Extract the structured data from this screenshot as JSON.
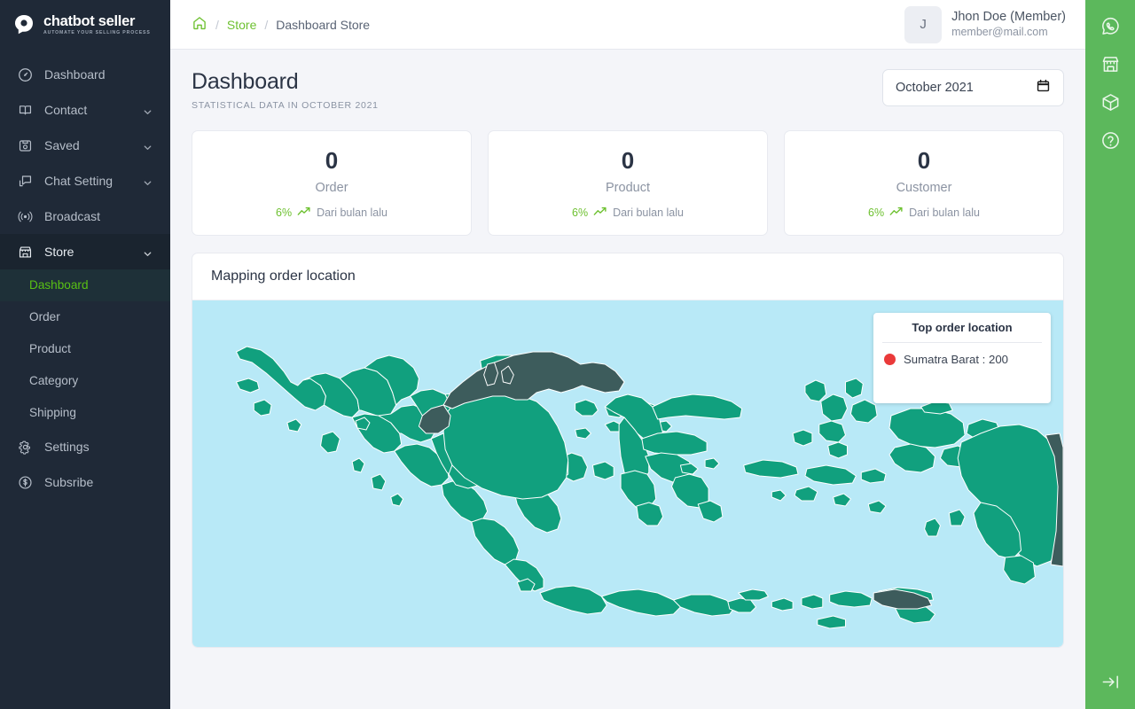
{
  "brand": {
    "name": "chatbot seller",
    "tagline": "AUTOMATE YOUR SELLING PROCESS",
    "logo_icon": "chat-bubble-logo"
  },
  "sidebar": {
    "items": [
      {
        "label": "Dashboard",
        "icon": "gauge-icon",
        "expandable": false,
        "active": false
      },
      {
        "label": "Contact",
        "icon": "book-icon",
        "expandable": true,
        "active": false
      },
      {
        "label": "Saved",
        "icon": "floppy-disk-icon",
        "expandable": true,
        "active": false
      },
      {
        "label": "Chat Setting",
        "icon": "chat-settings-icon",
        "expandable": true,
        "active": false
      },
      {
        "label": "Broadcast",
        "icon": "broadcast-icon",
        "expandable": false,
        "active": false
      },
      {
        "label": "Store",
        "icon": "store-icon",
        "expandable": true,
        "active": true
      }
    ],
    "store_subitems": [
      {
        "label": "Dashboard",
        "current": true
      },
      {
        "label": "Order",
        "current": false
      },
      {
        "label": "Product",
        "current": false
      },
      {
        "label": "Category",
        "current": false
      },
      {
        "label": "Shipping",
        "current": false
      }
    ],
    "footer_items": [
      {
        "label": "Settings",
        "icon": "gear-icon"
      },
      {
        "label": "Subsribe",
        "icon": "dollar-circle-icon"
      }
    ]
  },
  "topbar": {
    "breadcrumb": {
      "home_icon": "home-icon",
      "separator": "/",
      "link": "Store",
      "current": "Dashboard Store"
    },
    "profile": {
      "initial": "J",
      "name": "Jhon Doe (Member)",
      "email": "member@mail.com"
    }
  },
  "page": {
    "title": "Dashboard",
    "subtitle": "STATISTICAL DATA IN OCTOBER 2021",
    "date_picker": {
      "value": "October 2021",
      "icon": "calendar-icon"
    }
  },
  "stats": [
    {
      "value": "0",
      "label": "Order",
      "percent": "6%",
      "trend_icon": "trend-up-icon",
      "note": "Dari bulan lalu"
    },
    {
      "value": "0",
      "label": "Product",
      "percent": "6%",
      "trend_icon": "trend-up-icon",
      "note": "Dari bulan lalu"
    },
    {
      "value": "0",
      "label": "Customer",
      "percent": "6%",
      "trend_icon": "trend-up-icon",
      "note": "Dari bulan lalu"
    }
  ],
  "map_panel": {
    "title": "Mapping order location",
    "legend": {
      "title": "Top order location",
      "entries": [
        {
          "marker_color": "#ea3a3a",
          "label": "Sumatra Barat : 200"
        }
      ]
    }
  },
  "right_rail": {
    "items": [
      {
        "icon": "whatsapp-icon"
      },
      {
        "icon": "store-icon"
      },
      {
        "icon": "package-icon"
      },
      {
        "icon": "help-circle-icon"
      }
    ],
    "bottom": {
      "icon": "collapse-right-icon"
    }
  },
  "colors": {
    "sidebar_bg": "#1f2937",
    "accent_green": "#6ec131",
    "rail_green": "#5cb85c",
    "map_land": "#11a07e",
    "map_land_foreign": "#3d5c5c",
    "map_sea": "#b8e9f7",
    "marker_red": "#ea3a3a"
  }
}
